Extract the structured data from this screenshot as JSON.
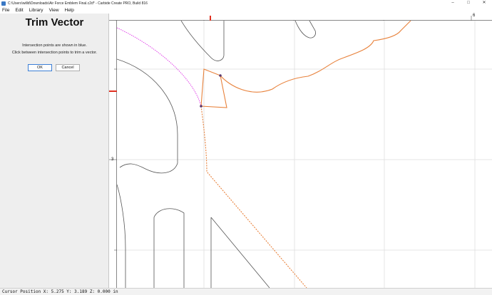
{
  "window": {
    "title": "C:\\Users\\willd\\Downloads\\Air Force Emblem Final.c2d* - Carbide Create PRO, Build 816",
    "minimize_glyph": "–",
    "maximize_glyph": "□",
    "close_glyph": "✕"
  },
  "menu": {
    "items": [
      "File",
      "Edit",
      "Library",
      "View",
      "Help"
    ]
  },
  "panel": {
    "title": "Trim Vector",
    "line1": "Intersection points are shown in blue.",
    "line2": "Click between intersection points to trim a vector.",
    "ok_label": "OK",
    "cancel_label": "Cancel"
  },
  "rulers": {
    "top_label": "6",
    "left_label": "3"
  },
  "status": {
    "text": "Cursor Position X: 5.275 Y: 3.189 Z: 0.000 in"
  },
  "colors": {
    "selected_vector": "#e8823c",
    "highlight_vector": "#e040e8",
    "grid": "#dedede",
    "ruler_marker": "#e03020",
    "vector": "#555555"
  }
}
